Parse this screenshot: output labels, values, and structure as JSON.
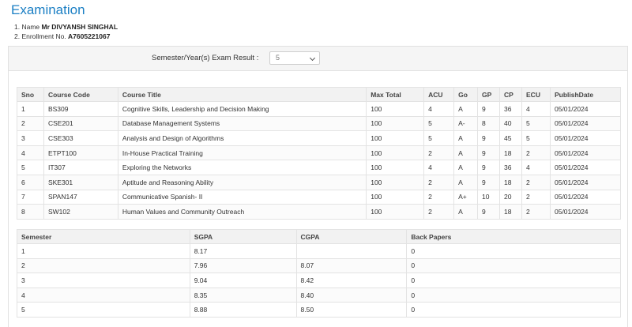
{
  "page": {
    "title": "Examination",
    "name_prefix": "1. Name ",
    "name_value": "Mr DIVYANSH SINGHAL",
    "enroll_prefix": "2. Enrollment No. ",
    "enroll_value": "A7605221067"
  },
  "semester_select": {
    "label": "Semester/Year(s) Exam Result :",
    "value": "5"
  },
  "courses": {
    "headers": [
      "Sno",
      "Course Code",
      "Course Title",
      "Max Total",
      "ACU",
      "Go",
      "GP",
      "CP",
      "ECU",
      "PublishDate"
    ],
    "rows": [
      [
        "1",
        "BS309",
        "Cognitive Skills, Leadership and Decision Making",
        "100",
        "4",
        "A",
        "9",
        "36",
        "4",
        "05/01/2024"
      ],
      [
        "2",
        "CSE201",
        "Database Management Systems",
        "100",
        "5",
        "A-",
        "8",
        "40",
        "5",
        "05/01/2024"
      ],
      [
        "3",
        "CSE303",
        "Analysis and Design of Algorithms",
        "100",
        "5",
        "A",
        "9",
        "45",
        "5",
        "05/01/2024"
      ],
      [
        "4",
        "ETPT100",
        "In-House Practical Training",
        "100",
        "2",
        "A",
        "9",
        "18",
        "2",
        "05/01/2024"
      ],
      [
        "5",
        "IT307",
        "Exploring the Networks",
        "100",
        "4",
        "A",
        "9",
        "36",
        "4",
        "05/01/2024"
      ],
      [
        "6",
        "SKE301",
        "Aptitude and Reasoning Ability",
        "100",
        "2",
        "A",
        "9",
        "18",
        "2",
        "05/01/2024"
      ],
      [
        "7",
        "SPAN147",
        "Communicative Spanish- II",
        "100",
        "2",
        "A+",
        "10",
        "20",
        "2",
        "05/01/2024"
      ],
      [
        "8",
        "SW102",
        "Human Values and Community Outreach",
        "100",
        "2",
        "A",
        "9",
        "18",
        "2",
        "05/01/2024"
      ]
    ]
  },
  "summary": {
    "headers": [
      "Semester",
      "SGPA",
      "CGPA",
      "Back Papers"
    ],
    "rows": [
      [
        "1",
        "8.17",
        "",
        "0"
      ],
      [
        "2",
        "7.96",
        "8.07",
        "0"
      ],
      [
        "3",
        "9.04",
        "8.42",
        "0"
      ],
      [
        "4",
        "8.35",
        "8.40",
        "0"
      ],
      [
        "5",
        "8.88",
        "8.50",
        "0"
      ]
    ]
  }
}
